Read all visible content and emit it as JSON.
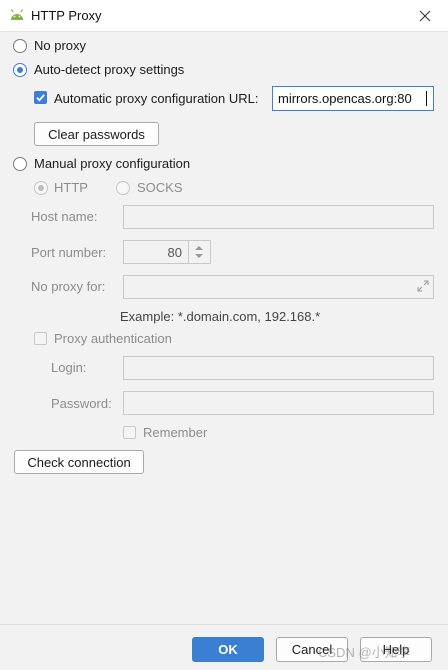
{
  "window": {
    "title": "HTTP Proxy"
  },
  "proxy": {
    "no_proxy_label": "No proxy",
    "auto_detect_label": "Auto-detect proxy settings",
    "auto_config_url_label": "Automatic proxy configuration URL:",
    "auto_config_url_value": "mirrors.opencas.org:80",
    "clear_passwords_label": "Clear passwords",
    "manual_label": "Manual proxy configuration",
    "http_label": "HTTP",
    "socks_label": "SOCKS",
    "host_name_label": "Host name:",
    "host_name_value": "",
    "port_number_label": "Port number:",
    "port_number_value": "80",
    "no_proxy_for_label": "No proxy for:",
    "no_proxy_for_value": "",
    "example_text": "Example: *.domain.com, 192.168.*",
    "proxy_auth_label": "Proxy authentication",
    "login_label": "Login:",
    "login_value": "",
    "password_label": "Password:",
    "password_value": "",
    "remember_label": "Remember",
    "check_connection_label": "Check connection"
  },
  "footer": {
    "ok_label": "OK",
    "cancel_label": "Cancel",
    "help_label": "Help",
    "watermark": "CSDN @小知李"
  },
  "colors": {
    "accent": "#3d7ed6",
    "ok_button": "#3a7fd1"
  },
  "icons": {
    "app": "android-icon",
    "close": "close-icon",
    "expand": "expand-icon"
  }
}
